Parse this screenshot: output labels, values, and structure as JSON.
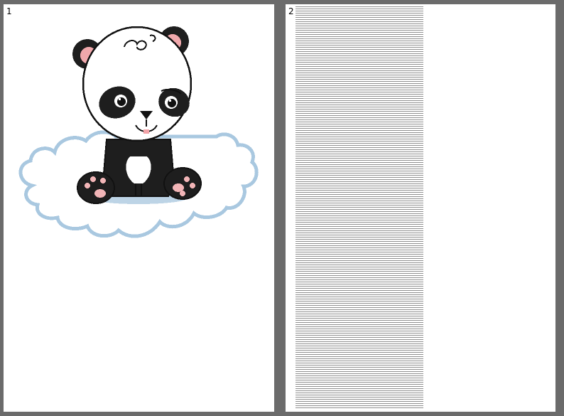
{
  "viewer": {
    "pages": [
      {
        "number": "1",
        "content": "panda-on-cloud-pixel-pattern"
      },
      {
        "number": "2",
        "content": "text-lines-block"
      }
    ]
  },
  "colors": {
    "background": "#6b6b6b",
    "page": "#ffffff",
    "panda_black": "#1e1e1e",
    "panda_outline": "#111111",
    "ear_pink": "#f0a8ac",
    "paw_pink": "#f2b5b7",
    "cloud_outline": "#a9c8e0",
    "cloud_shadow": "#bdd4e6",
    "text_lines": "#8f8f8f"
  }
}
